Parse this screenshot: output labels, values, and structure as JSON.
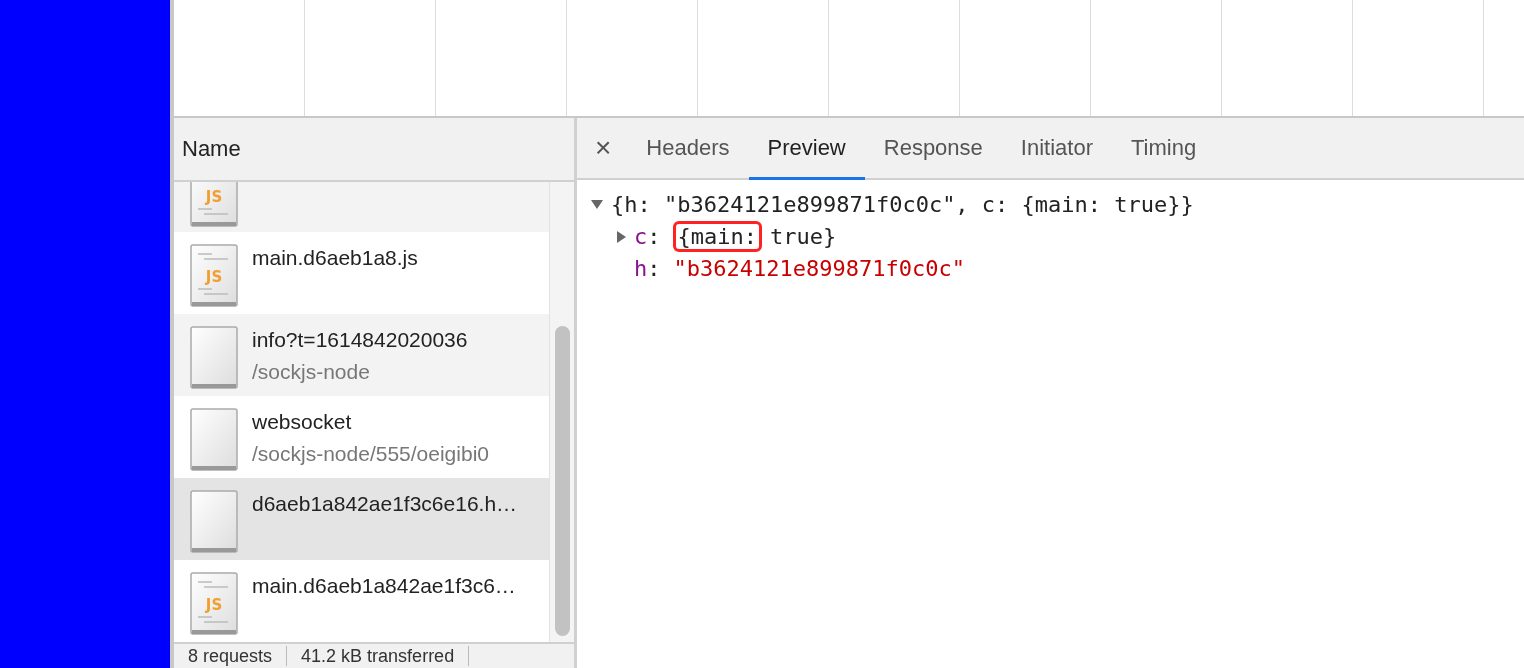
{
  "requests": {
    "header": "Name",
    "rows": [
      {
        "kind": "script",
        "icon_text": "JS",
        "selected": false
      },
      {
        "kind": "script",
        "icon_text": "JS",
        "name": "main.d6aeb1a8.js",
        "selected": false
      },
      {
        "kind": "blank",
        "name": "info?t=1614842020036",
        "path": "/sockjs-node",
        "selected": false
      },
      {
        "kind": "blank",
        "name": "websocket",
        "path": "/sockjs-node/555/oeigibi0",
        "selected": false
      },
      {
        "kind": "blank",
        "name": "d6aeb1a842ae1f3c6e16.h…",
        "selected": true
      },
      {
        "kind": "script",
        "icon_text": "JS",
        "name": "main.d6aeb1a842ae1f3c6…",
        "selected": false
      }
    ]
  },
  "status_bar": [
    "8 requests",
    "41.2 kB transferred"
  ],
  "detail": {
    "close": "×",
    "tabs": [
      {
        "label": "Headers",
        "selected": false
      },
      {
        "label": "Preview",
        "selected": true
      },
      {
        "label": "Response",
        "selected": false
      },
      {
        "label": "Initiator",
        "selected": false
      },
      {
        "label": "Timing",
        "selected": false
      }
    ],
    "preview": [
      {
        "kind": "summary",
        "expanded": true,
        "text": "{h: \"b3624121e899871f0c0c\", c: {main: true}}"
      },
      {
        "kind": "object",
        "expanded": false,
        "key": "c",
        "separator": ":",
        "parts": [
          {
            "text": "{main:",
            "highlighted": true
          },
          {
            "text": "true}",
            "highlighted": false
          }
        ]
      },
      {
        "kind": "string",
        "key": "h",
        "separator": ":",
        "value": "\"b3624121e899871f0c0c\""
      }
    ]
  }
}
